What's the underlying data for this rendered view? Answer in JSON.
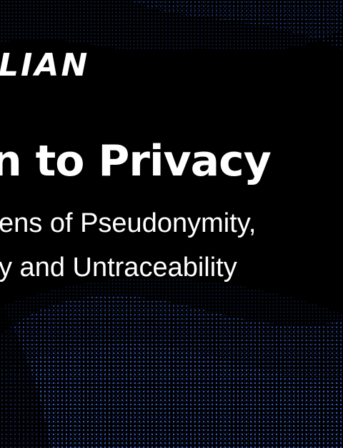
{
  "banner": {
    "logo_text": "LIAN",
    "headline": "n to Privacy",
    "subtitle_line1": "ens of Pseudonymity,",
    "subtitle_line2": "y and Untraceability"
  },
  "colors": {
    "background": "#000000",
    "text": "#ffffff",
    "dots": "#3a5fc8"
  }
}
